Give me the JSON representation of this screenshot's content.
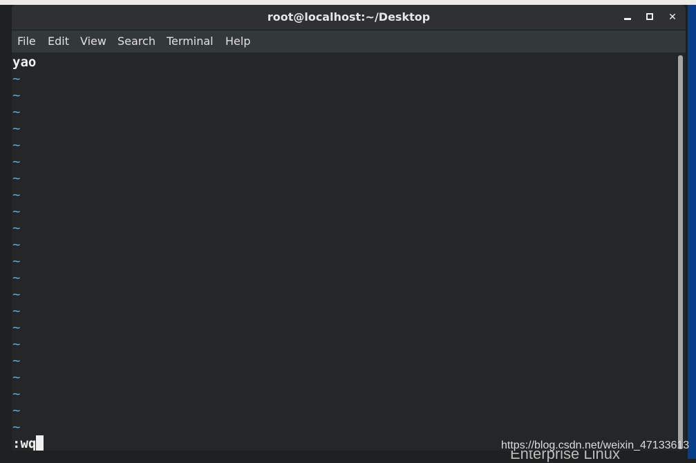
{
  "window": {
    "title": "root@localhost:~/Desktop",
    "buttons": {
      "minimize": "minimize-icon",
      "maximize": "maximize-icon",
      "close": "close-icon"
    }
  },
  "menu": [
    "File",
    "Edit",
    "View",
    "Search",
    "Terminal",
    "Help"
  ],
  "editor": {
    "lines": [
      "yao"
    ],
    "empty_marker": "~",
    "empty_count": 22,
    "command": ":wq"
  },
  "background": {
    "desktop_text": "Enterprise Linux",
    "watermark": "https://blog.csdn.net/weixin_47133613"
  },
  "colors": {
    "tilde": "#6f9fd8",
    "terminal_bg": "#232729",
    "desktop_accent": "#063e8c"
  }
}
